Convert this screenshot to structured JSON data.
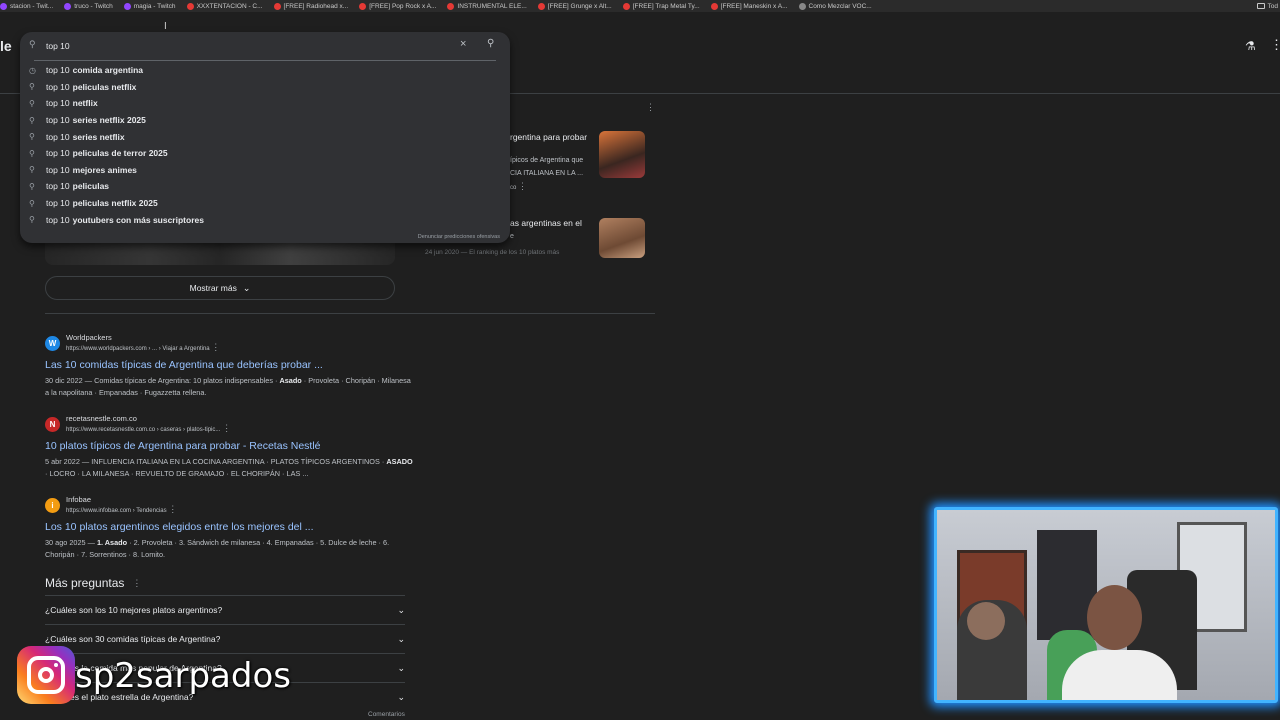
{
  "bookmarks": [
    {
      "label": "stacion - Twit...",
      "icon": "twitch-icon",
      "kind": "tw"
    },
    {
      "label": "truco - Twitch",
      "icon": "twitch-icon",
      "kind": "tw"
    },
    {
      "label": "magia - Twitch",
      "icon": "twitch-icon",
      "kind": "tw"
    },
    {
      "label": "XXXTENTACION - C...",
      "icon": "youtube-icon",
      "kind": "yt"
    },
    {
      "label": "[FREE] Radiohead x...",
      "icon": "youtube-icon",
      "kind": "yt"
    },
    {
      "label": "[FREE] Pop Rock x A...",
      "icon": "youtube-icon",
      "kind": "yt"
    },
    {
      "label": "INSTRUMENTAL ELE...",
      "icon": "youtube-icon",
      "kind": "yt"
    },
    {
      "label": "[FREE] Grunge x Alt...",
      "icon": "youtube-icon",
      "kind": "yt"
    },
    {
      "label": "[FREE] Trap Metal Ty...",
      "icon": "youtube-icon",
      "kind": "yt"
    },
    {
      "label": "[FREE] Maneskin x A...",
      "icon": "youtube-icon",
      "kind": "yt"
    },
    {
      "label": "Como Mezclar VOC...",
      "icon": "globe-icon",
      "kind": "gl"
    }
  ],
  "bookmarks_right": "Tod",
  "logo_fragment": "le",
  "search": {
    "value": "top 10",
    "clear_icon": "×",
    "search_icon": "🔍",
    "report_label": "Denunciar predicciones ofensivas",
    "suggestions": [
      {
        "icon": "history-icon",
        "prefix": "top 10",
        "completion": "comida argentina"
      },
      {
        "icon": "search-icon",
        "prefix": "top 10",
        "completion": "peliculas netflix"
      },
      {
        "icon": "search-icon",
        "prefix": "top 10",
        "completion": "netflix"
      },
      {
        "icon": "search-icon",
        "prefix": "top 10",
        "completion": "series netflix 2025"
      },
      {
        "icon": "search-icon",
        "prefix": "top 10",
        "completion": "series netflix"
      },
      {
        "icon": "search-icon",
        "prefix": "top 10",
        "completion": "peliculas de terror 2025"
      },
      {
        "icon": "search-icon",
        "prefix": "top 10",
        "completion": "mejores animes"
      },
      {
        "icon": "search-icon",
        "prefix": "top 10",
        "completion": "peliculas"
      },
      {
        "icon": "search-icon",
        "prefix": "top 10",
        "completion": "peliculas netflix 2025"
      },
      {
        "icon": "search-icon",
        "prefix": "top 10",
        "completion": "youtubers con más suscriptores"
      }
    ]
  },
  "side_cards": [
    {
      "title": "rgentina para probar",
      "snippet1": "ípicos de Argentina que",
      "snippet2": "CIA ITALIANA EN LA ...",
      "meta": "co"
    },
    {
      "title": "as argentinas en el",
      "snippet1": "e",
      "snippet2": "24 jun 2020 — El ranking de los 10 platos más",
      "meta": ""
    }
  ],
  "mostrar_mas": "Mostrar más",
  "results": [
    {
      "site": "Worldpackers",
      "url": "https://www.worldpackers.com › ... › Viajar a Argentina",
      "title": "Las 10 comidas típicas de Argentina que deberías probar ...",
      "date": "30 dic 2022 — Comidas típicas de Argentina: 10 platos indispensables · ",
      "bold": "Asado",
      "rest": " · Provoleta · Choripán · Milanesa a la napolitana · Empanadas · Fugazzetta rellena.",
      "fav": "W",
      "color": "#1e88e5"
    },
    {
      "site": "recetasnestle.com.co",
      "url": "https://www.recetasnestle.com.co › caseras › platos-tipic...",
      "title": "10 platos típicos de Argentina para probar - Recetas Nestlé",
      "date": "5 abr 2022 — INFLUENCIA ITALIANA EN LA COCINA ARGENTINA · PLATOS TÍPICOS ARGENTINOS · ",
      "bold": "ASADO",
      "rest": " · LOCRO · LA MILANESA · REVUELTO DE GRAMAJO · EL CHORIPÁN · LAS ...",
      "fav": "N",
      "color": "#c62828"
    },
    {
      "site": "Infobae",
      "url": "https://www.infobae.com › Tendencias",
      "title": "Los 10 platos argentinos elegidos entre los mejores del ...",
      "date": "30 ago 2025 — ",
      "bold": "1. Asado",
      "rest": " · 2. Provoleta · 3. Sándwich de milanesa · 4. Empanadas · 5. Dulce de leche · 6. Choripán · 7. Sorrentinos · 8. Lomito.",
      "fav": "i",
      "color": "#f39c12"
    }
  ],
  "mas_preguntas": "Más preguntas",
  "questions": [
    "¿Cuáles son los 10 mejores platos argentinos?",
    "¿Cuáles son 30 comidas típicas de Argentina?",
    "¿Cuál es la comida más popular de Argentina?",
    "¿Cuál es el plato estrella de Argentina?"
  ],
  "comentarios": "Comentarios",
  "instagram_handle": "sp2sarpados",
  "colors": {
    "accent_link": "#99c3ff",
    "background": "#1f1f1f",
    "cam_glow": "#42b4ff"
  }
}
